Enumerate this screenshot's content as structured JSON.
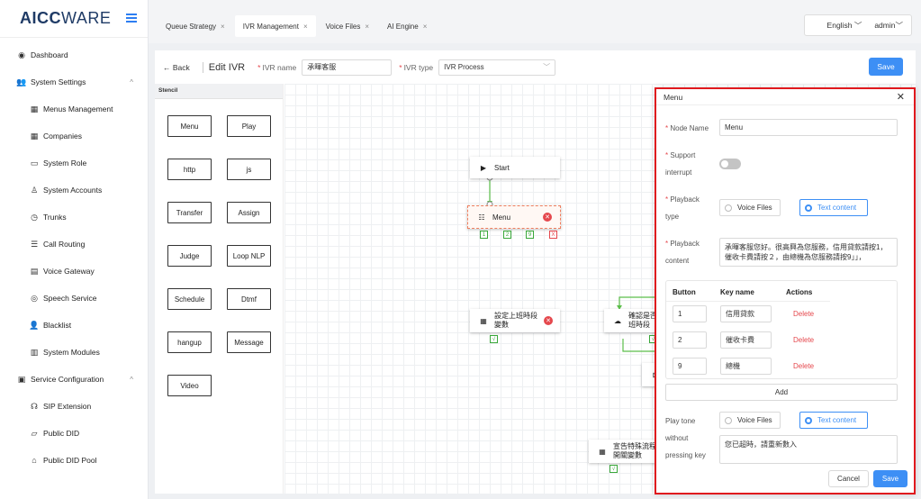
{
  "brand": {
    "logo_bold": "AICC",
    "logo_rest": "WARE"
  },
  "sidebar": {
    "items": [
      {
        "label": "Dashboard",
        "icon": "dashboard-icon",
        "glyph": "◉",
        "level": "top"
      },
      {
        "label": "System Settings",
        "icon": "users-icon",
        "glyph": "👥",
        "level": "top",
        "arrow": "^"
      },
      {
        "label": "Menus Management",
        "icon": "grid-icon",
        "glyph": "▦",
        "level": "sub"
      },
      {
        "label": "Companies",
        "icon": "apps-icon",
        "glyph": "▦",
        "level": "sub"
      },
      {
        "label": "System Role",
        "icon": "id-card-icon",
        "glyph": "▭",
        "level": "sub"
      },
      {
        "label": "System Accounts",
        "icon": "user-icon",
        "glyph": "♙",
        "level": "sub"
      },
      {
        "label": "Trunks",
        "icon": "clock-icon",
        "glyph": "◷",
        "level": "sub"
      },
      {
        "label": "Call Routing",
        "icon": "list-icon",
        "glyph": "☰",
        "level": "sub"
      },
      {
        "label": "Voice Gateway",
        "icon": "calendar-icon",
        "glyph": "▤",
        "level": "sub"
      },
      {
        "label": "Speech Service",
        "icon": "globe-icon",
        "glyph": "◎",
        "level": "sub"
      },
      {
        "label": "Blacklist",
        "icon": "person-icon",
        "glyph": "👤",
        "level": "sub"
      },
      {
        "label": "System Modules",
        "icon": "table-icon",
        "glyph": "▥",
        "level": "sub"
      },
      {
        "label": "Service Configuration",
        "icon": "server-icon",
        "glyph": "▣",
        "level": "top",
        "arrow": "^"
      },
      {
        "label": "SIP Extension",
        "icon": "headset-icon",
        "glyph": "☊",
        "level": "sub"
      },
      {
        "label": "Public DID",
        "icon": "folder-icon",
        "glyph": "▱",
        "level": "sub"
      },
      {
        "label": "Public DID Pool",
        "icon": "home-icon",
        "glyph": "⌂",
        "level": "sub"
      }
    ]
  },
  "tabs": [
    {
      "label": "Queue Strategy",
      "active": false
    },
    {
      "label": "IVR Management",
      "active": true
    },
    {
      "label": "Voice Files",
      "active": false
    },
    {
      "label": "AI Engine",
      "active": false
    }
  ],
  "topright": {
    "language": "English",
    "user": "admin"
  },
  "header": {
    "back": "Back",
    "title": "Edit IVR",
    "ivr_name_label": "IVR name",
    "ivr_name_value": "承暉客服",
    "ivr_type_label": "IVR type",
    "ivr_type_value": "IVR Process",
    "save": "Save"
  },
  "stencil": {
    "title": "Stencil",
    "buttons": [
      "Menu",
      "Play",
      "http",
      "js",
      "Transfer",
      "Assign",
      "Judge",
      "Loop NLP",
      "Schedule",
      "Dtmf",
      "hangup",
      "Message",
      "Video"
    ]
  },
  "canvas": {
    "nodes": [
      {
        "id": "start",
        "label": "Start"
      },
      {
        "id": "menu",
        "label": "Menu",
        "ports": [
          "1",
          "2",
          "9",
          "X"
        ]
      },
      {
        "id": "n1",
        "label": "設定上班時段\n變數"
      },
      {
        "id": "n2",
        "label": "確認是否為上\n班時段"
      },
      {
        "id": "n3",
        "label": "導\n班"
      },
      {
        "id": "n4",
        "label": "宣告特殊流程\n開關變數"
      }
    ]
  },
  "panel": {
    "title": "Menu",
    "node_name_label": "Node Name",
    "node_name_value": "Menu",
    "support_label_1": "Support",
    "support_label_2": "interrupt",
    "playback_type_label_1": "Playback",
    "playback_type_label_2": "type",
    "opt_voice": "Voice Files",
    "opt_text": "Text content",
    "playback_content_label_1": "Playback",
    "playback_content_label_2": "content",
    "playback_content_value": "承暉客服您好。很高興為您服務，信用貸款請按1，催收卡費請按２，由總機為您服務請按9」」，",
    "table": {
      "headers": [
        "Button",
        "Key name",
        "Actions"
      ],
      "rows": [
        {
          "button": "1",
          "key": "信用貸款",
          "action": "Delete"
        },
        {
          "button": "2",
          "key": "催收卡費",
          "action": "Delete"
        },
        {
          "button": "9",
          "key": "總機",
          "action": "Delete"
        }
      ]
    },
    "add": "Add",
    "tone_label_1": "Play tone",
    "tone_label_2": "without",
    "tone_label_3": "pressing key",
    "tone_content": "您已超時，請重新數入",
    "cancel": "Cancel",
    "save": "Save"
  },
  "colors": {
    "primary": "#3d8ff5",
    "danger": "#e5484d",
    "edge": "#5cbf4a",
    "highlight": "#e0191e"
  }
}
